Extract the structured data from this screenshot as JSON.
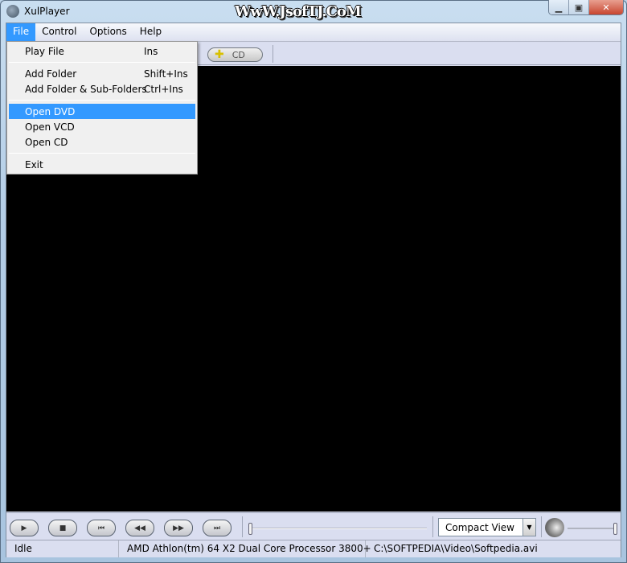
{
  "window": {
    "title": "XulPlayer",
    "watermark": "WwW.JsofTJ.CoM",
    "controls": {
      "minimize": "▁",
      "maximize": "▣",
      "close": "✕"
    }
  },
  "menubar": {
    "items": [
      {
        "label": "File"
      },
      {
        "label": "Control"
      },
      {
        "label": "Options"
      },
      {
        "label": "Help"
      }
    ]
  },
  "file_menu": {
    "items": [
      {
        "label": "Play File",
        "shortcut": "Ins"
      },
      {
        "label": "Add Folder",
        "shortcut": "Shift+Ins"
      },
      {
        "label": "Add Folder & Sub-Folders",
        "shortcut": "Ctrl+Ins"
      },
      {
        "label": "Open DVD",
        "highlighted": true
      },
      {
        "label": "Open VCD"
      },
      {
        "label": "Open CD"
      },
      {
        "label": "Exit"
      }
    ]
  },
  "toolbar": {
    "cd_label": "CD",
    "cd_icon": "plus-icon"
  },
  "controls": {
    "play": "▶",
    "stop": "■",
    "prev": "⏮",
    "rewind": "◀◀",
    "forward": "▶▶",
    "next": "⏭",
    "seek_position": 0,
    "view_select": "Compact View",
    "volume": 1.0
  },
  "status": {
    "state": "Idle",
    "cpu": "AMD Athlon(tm) 64 X2 Dual Core Processor 3800+",
    "file": "C:\\SOFTPEDIA\\Video\\Softpedia.avi"
  },
  "colors": {
    "highlight": "#3399ff",
    "video_bg": "#000000"
  }
}
